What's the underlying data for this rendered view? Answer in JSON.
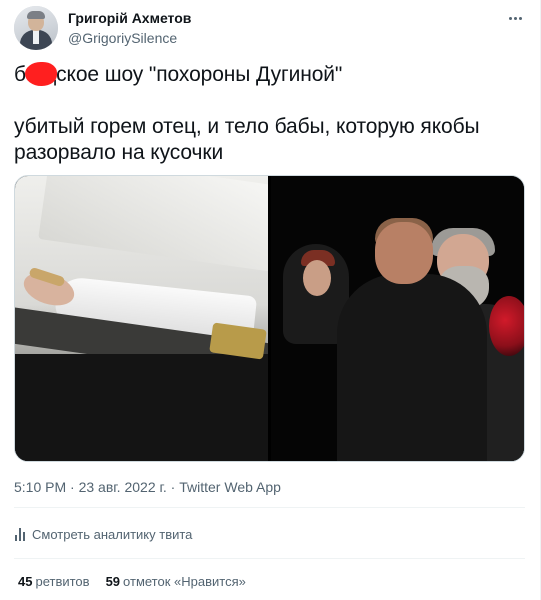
{
  "author": {
    "display_name": "Григорій Ахметов",
    "handle": "@GrigoriySilence"
  },
  "menu_icon": "more-horizontal-icon",
  "tweet": {
    "line1_prefix": "б",
    "line1_rest": "дское шоу \"похороны Дугиной\"",
    "line2": "убитый горем отец, и тело бабы, которую якобы",
    "line3": "разорвало на кусочки"
  },
  "media": {
    "count": 2
  },
  "meta": {
    "time": "5:10 PM",
    "date": "23 авг. 2022 г.",
    "source": "Twitter Web App",
    "separator": "·"
  },
  "analytics": {
    "icon": "analytics-bars-icon",
    "label": "Смотреть аналитику твита"
  },
  "stats": {
    "retweets_count": "45",
    "retweets_label": "ретвитов",
    "likes_count": "59",
    "likes_label": "отметок «Нравится»"
  },
  "colors": {
    "text_primary": "#0f1419",
    "text_secondary": "#536471",
    "divider": "#eff3f4",
    "censor_mark": "#ff1f1f"
  }
}
